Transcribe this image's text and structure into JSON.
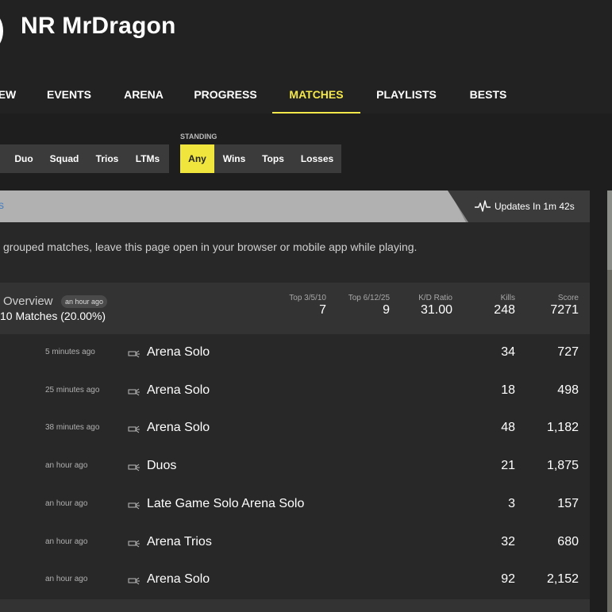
{
  "header": {
    "player_name": "NR MrDragon"
  },
  "nav": {
    "tabs": [
      {
        "label": "EW",
        "active": false
      },
      {
        "label": "EVENTS",
        "active": false
      },
      {
        "label": "ARENA",
        "active": false
      },
      {
        "label": "PROGRESS",
        "active": false
      },
      {
        "label": "MATCHES",
        "active": true
      },
      {
        "label": "PLAYLISTS",
        "active": false
      },
      {
        "label": "BESTS",
        "active": false
      }
    ]
  },
  "filters": {
    "mode_buttons": [
      "Duo",
      "Squad",
      "Trios",
      "LTMs"
    ],
    "standing_label": "STANDING",
    "standing_buttons": [
      {
        "label": "Any",
        "active": true
      },
      {
        "label": "Wins",
        "active": false
      },
      {
        "label": "Tops",
        "active": false
      },
      {
        "label": "Losses",
        "active": false
      }
    ]
  },
  "updates": {
    "left_fragment": "s",
    "text": "Updates In 1m 42s"
  },
  "info_text": "grouped matches, leave this page open in your browser or mobile app while playing.",
  "overview": {
    "title": "Overview",
    "badge": "an hour ago",
    "subtitle": "10 Matches (20.00%)",
    "stats": [
      {
        "label": "Top 3/5/10",
        "value": "7"
      },
      {
        "label": "Top 6/12/25",
        "value": "9"
      },
      {
        "label": "K/D Ratio",
        "value": "31.00"
      },
      {
        "label": "Kills",
        "value": "248"
      },
      {
        "label": "Score",
        "value": "7271"
      }
    ]
  },
  "matches": [
    {
      "time": "5 minutes ago",
      "mode": "Arena Solo",
      "kills": "34",
      "score": "727"
    },
    {
      "time": "25 minutes ago",
      "mode": "Arena Solo",
      "kills": "18",
      "score": "498"
    },
    {
      "time": "38 minutes ago",
      "mode": "Arena Solo",
      "kills": "48",
      "score": "1,182"
    },
    {
      "time": "an hour ago",
      "mode": "Duos",
      "kills": "21",
      "score": "1,875"
    },
    {
      "time": "an hour ago",
      "mode": "Late Game Solo Arena Solo",
      "kills": "3",
      "score": "157"
    },
    {
      "time": "an hour ago",
      "mode": "Arena Trios",
      "kills": "32",
      "score": "680"
    },
    {
      "time": "an hour ago",
      "mode": "Arena Solo",
      "kills": "92",
      "score": "2,152"
    }
  ],
  "colors": {
    "accent": "#f5e84a",
    "background": "#1e1e1e",
    "panel": "#282828",
    "updates_bar": "#b1b1b1"
  }
}
